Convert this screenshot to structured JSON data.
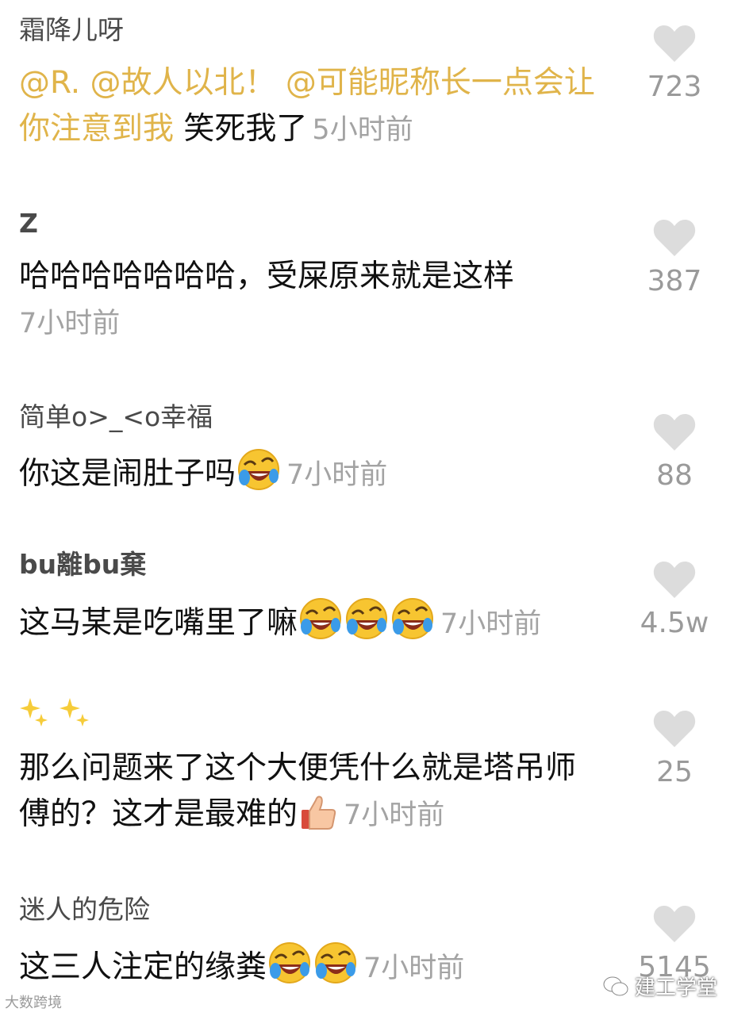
{
  "comments": [
    {
      "user": "霜降儿呀",
      "mentions": "@R. @故人以北！ @可能昵称长一点会让你注意到我",
      "text": " 笑死我了",
      "time": "5小时前",
      "likes": "723"
    },
    {
      "user": "Z",
      "text": "哈哈哈哈哈哈哈，受屎原来就是这样",
      "time": "7小时前",
      "likes": "387"
    },
    {
      "user": "简单o>_<o幸福",
      "text": "你这是闹肚子吗",
      "time": "7小时前",
      "likes": "88",
      "emoji_count": 1
    },
    {
      "user": "bu離bu棄",
      "text": "这马某是吃嘴里了嘛",
      "time": "7小时前",
      "likes": "4.5w",
      "emoji_count": 3
    },
    {
      "user": "",
      "text": "那么问题来了这个大便凭什么就是塔吊师傅的？这才是最难的",
      "time": "7小时前",
      "likes": "25"
    },
    {
      "user": "迷人的危险",
      "text": "这三人注定的缘粪",
      "time": "7小时前",
      "likes": "5145",
      "emoji_count": 2
    }
  ],
  "icons": {
    "like": "heart-icon",
    "laugh": "laughing-crying-emoji",
    "thumbs": "thumbs-up-emoji",
    "sparkle": "sparkles-emoji"
  },
  "colors": {
    "mention": "#e0b44a",
    "heart": "#dcdcdc",
    "time": "#a3a3a3"
  },
  "watermarks": {
    "left": "大数跨境",
    "right": "建工学堂"
  }
}
